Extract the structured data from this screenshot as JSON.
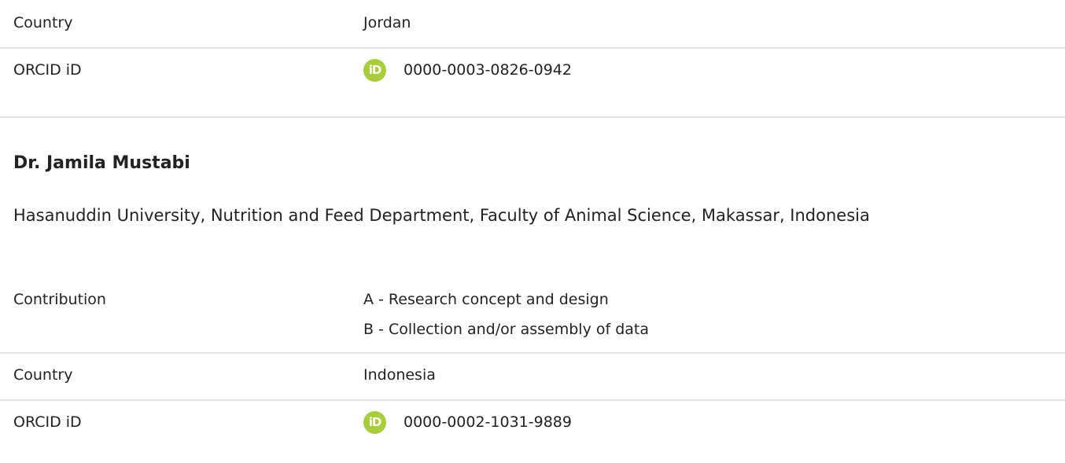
{
  "previous_author": {
    "country_label": "Country",
    "country_value": "Jordan",
    "orcid_label": "ORCID iD",
    "orcid_icon": "orcid-icon",
    "orcid_icon_text": "iD",
    "orcid_value": "0000-0003-0826-0942"
  },
  "author": {
    "name": "Dr. Jamila Mustabi",
    "affiliation": "Hasanuddin University, Nutrition and Feed Department, Faculty of Animal Science, Makassar, Indonesia",
    "contribution_label": "Contribution",
    "contributions": [
      "A - Research concept and design",
      "B - Collection and/or assembly of data"
    ],
    "country_label": "Country",
    "country_value": "Indonesia",
    "orcid_label": "ORCID iD",
    "orcid_icon": "orcid-icon",
    "orcid_icon_text": "iD",
    "orcid_value": "0000-0002-1031-9889"
  },
  "colors": {
    "orcid_green": "#a6ce39",
    "separator": "#e4e4e4",
    "text": "#222222"
  }
}
